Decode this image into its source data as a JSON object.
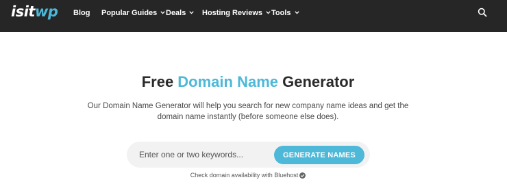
{
  "logo": {
    "part1": "isit",
    "part2": "wp"
  },
  "nav": {
    "items": [
      {
        "label": "Blog",
        "has_dropdown": false
      },
      {
        "label": "Popular Guides",
        "has_dropdown": true
      },
      {
        "label": "Deals",
        "has_dropdown": true
      },
      {
        "label": "Hosting Reviews",
        "has_dropdown": true
      },
      {
        "label": "Tools",
        "has_dropdown": true
      }
    ],
    "search_icon": "search-icon"
  },
  "hero": {
    "title_pre": "Free ",
    "title_accent": "Domain Name",
    "title_post": " Generator",
    "description": "Our Domain Name Generator will help you search for new company name ideas and get the domain name instantly (before someone else does)."
  },
  "search": {
    "placeholder": "Enter one or two keywords...",
    "value": "",
    "button_label": "GENERATE NAMES"
  },
  "footer_note": {
    "text": "Check domain availability with Bluehost",
    "icon": "check-circle-icon"
  },
  "colors": {
    "topbar": "#262626",
    "accent": "#4db8d8",
    "search_bg": "#f2f2f2"
  }
}
